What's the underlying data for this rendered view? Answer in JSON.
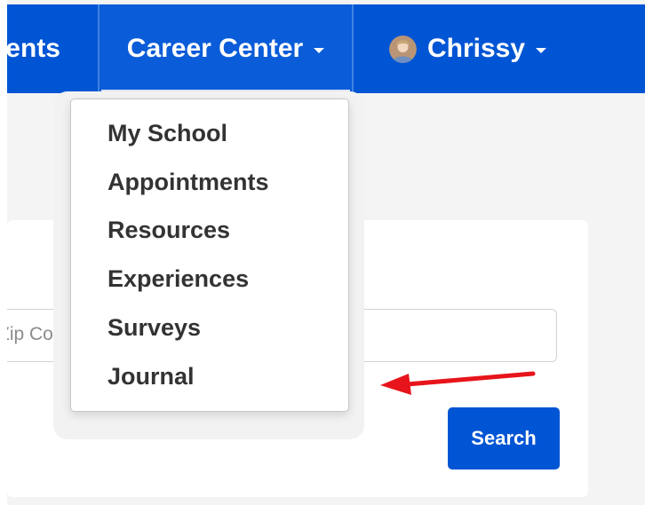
{
  "navbar": {
    "students_label": "Students",
    "career_label": "Career Center",
    "user_name": "Chrissy"
  },
  "dropdown": {
    "items": [
      {
        "label": "My School"
      },
      {
        "label": "Appointments"
      },
      {
        "label": "Resources"
      },
      {
        "label": "Experiences"
      },
      {
        "label": "Surveys"
      },
      {
        "label": "Journal"
      }
    ]
  },
  "search": {
    "zip_placeholder": "Zip Code",
    "button_label": "Search"
  },
  "colors": {
    "brand_blue": "#0055d4",
    "annotation_arrow": "#e8141b"
  }
}
